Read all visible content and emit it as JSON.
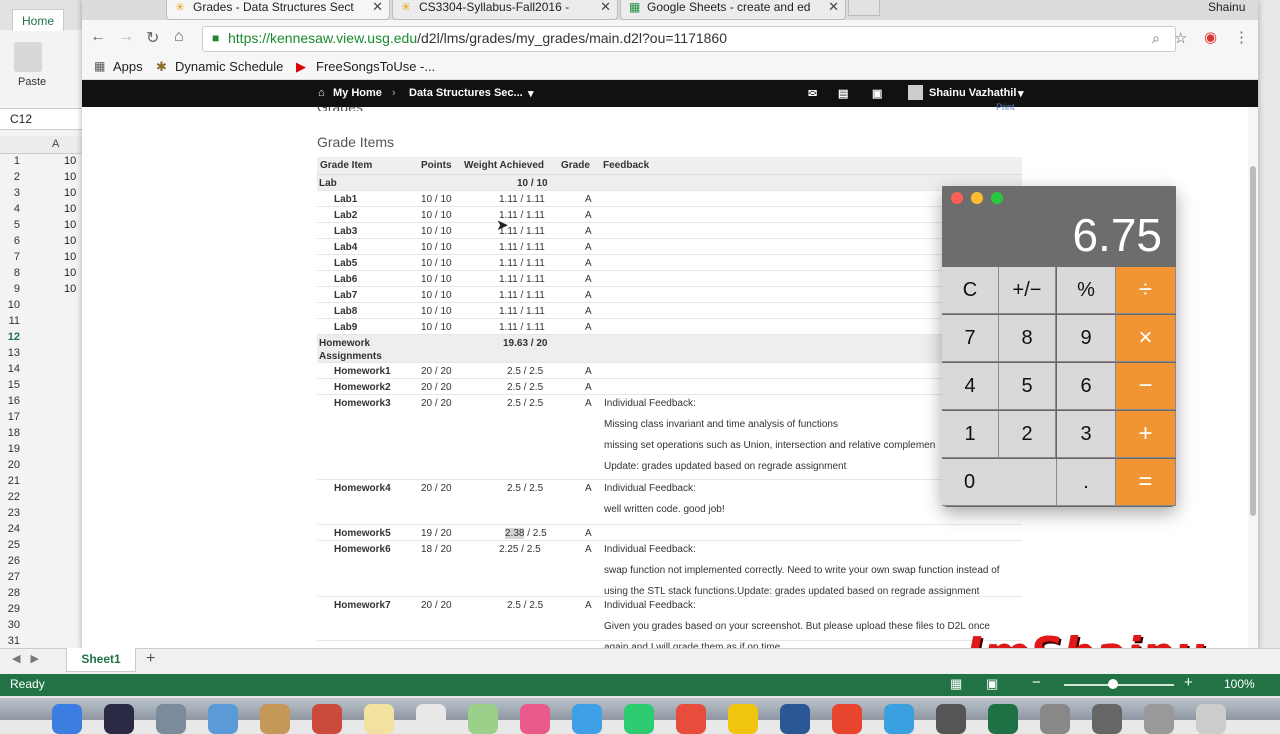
{
  "excel": {
    "home_tab": "Home",
    "paste_label": "Paste",
    "cell_ref": "C12",
    "col_header": "A",
    "rows": [
      {
        "n": "1",
        "v": "10"
      },
      {
        "n": "2",
        "v": "10"
      },
      {
        "n": "3",
        "v": "10"
      },
      {
        "n": "4",
        "v": "10"
      },
      {
        "n": "5",
        "v": "10"
      },
      {
        "n": "6",
        "v": "10"
      },
      {
        "n": "7",
        "v": "10"
      },
      {
        "n": "8",
        "v": "10"
      },
      {
        "n": "9",
        "v": "10"
      },
      {
        "n": "10",
        "v": ""
      },
      {
        "n": "11",
        "v": ""
      },
      {
        "n": "12",
        "v": ""
      },
      {
        "n": "13",
        "v": ""
      },
      {
        "n": "14",
        "v": ""
      },
      {
        "n": "15",
        "v": ""
      },
      {
        "n": "16",
        "v": ""
      },
      {
        "n": "17",
        "v": ""
      },
      {
        "n": "18",
        "v": ""
      },
      {
        "n": "19",
        "v": ""
      },
      {
        "n": "20",
        "v": ""
      },
      {
        "n": "21",
        "v": ""
      },
      {
        "n": "22",
        "v": ""
      },
      {
        "n": "23",
        "v": ""
      },
      {
        "n": "24",
        "v": ""
      },
      {
        "n": "25",
        "v": ""
      },
      {
        "n": "26",
        "v": ""
      },
      {
        "n": "27",
        "v": ""
      },
      {
        "n": "28",
        "v": ""
      },
      {
        "n": "29",
        "v": ""
      },
      {
        "n": "30",
        "v": ""
      },
      {
        "n": "31",
        "v": ""
      }
    ],
    "sheet_tab": "Sheet1",
    "add_sheet": "+",
    "status": "Ready",
    "zoom": "100%",
    "zoom_minus": "−",
    "zoom_plus": "+"
  },
  "browser": {
    "tabs": [
      {
        "title": "Grades - Data Structures Sect",
        "icon": "✳"
      },
      {
        "title": "CS3304-Syllabus-Fall2016 - ",
        "icon": "✳"
      },
      {
        "title": "Google Sheets - create and ed",
        "icon": "▦"
      }
    ],
    "profile": "Shainu",
    "url_host": "https://kennesaw.view.usg.edu",
    "url_path": "/d2l/lms/grades/my_grades/main.d2l?ou=1171860",
    "bookmarks": [
      "Apps",
      "Dynamic Schedule",
      "FreeSongsToUse -..."
    ]
  },
  "d2l": {
    "nav_home": "My Home",
    "nav_course": "Data Structures Sec...",
    "user": "Shainu Vazhathil",
    "page_title": "Grades",
    "print": "Print",
    "section_title": "Grade Items",
    "columns": [
      "Grade Item",
      "Points",
      "Weight Achieved",
      "Grade",
      "Feedback"
    ],
    "lab_category": {
      "name": "Lab",
      "weight": "10 / 10"
    },
    "labs": [
      {
        "name": "Lab1",
        "points": "10 / 10",
        "weight": "1.11 / 1.11",
        "grade": "A"
      },
      {
        "name": "Lab2",
        "points": "10 / 10",
        "weight": "1.11 / 1.11",
        "grade": "A"
      },
      {
        "name": "Lab3",
        "points": "10 / 10",
        "weight": "1.11 / 1.11",
        "grade": "A"
      },
      {
        "name": "Lab4",
        "points": "10 / 10",
        "weight": "1.11 / 1.11",
        "grade": "A"
      },
      {
        "name": "Lab5",
        "points": "10 / 10",
        "weight": "1.11 / 1.11",
        "grade": "A"
      },
      {
        "name": "Lab6",
        "points": "10 / 10",
        "weight": "1.11 / 1.11",
        "grade": "A"
      },
      {
        "name": "Lab7",
        "points": "10 / 10",
        "weight": "1.11 / 1.11",
        "grade": "A"
      },
      {
        "name": "Lab8",
        "points": "10 / 10",
        "weight": "1.11 / 1.11",
        "grade": "A"
      },
      {
        "name": "Lab9",
        "points": "10 / 10",
        "weight": "1.11 / 1.11",
        "grade": "A"
      }
    ],
    "hw_category": {
      "name_line1": "Homework",
      "name_line2": "Assignments",
      "weight": "19.63 / 20"
    },
    "homework": [
      {
        "name": "Homework1",
        "points": "20 / 20",
        "weight": "2.5 / 2.5",
        "grade": "A"
      },
      {
        "name": "Homework2",
        "points": "20 / 20",
        "weight": "2.5 / 2.5",
        "grade": "A"
      },
      {
        "name": "Homework3",
        "points": "20 / 20",
        "weight": "2.5 / 2.5",
        "grade": "A",
        "feedback": [
          "Individual Feedback:",
          "Missing class invariant and time analysis of functions",
          "missing set operations such as Union, intersection and relative complemen",
          "Update: grades updated based on regrade assignment"
        ]
      },
      {
        "name": "Homework4",
        "points": "20 / 20",
        "weight": "2.5 / 2.5",
        "grade": "A",
        "feedback": [
          "Individual Feedback:",
          "well written code. good job!"
        ]
      },
      {
        "name": "Homework5",
        "points": "19 / 20",
        "weight_hl": "2.38",
        "weight_rest": " / 2.5",
        "grade": "A"
      },
      {
        "name": "Homework6",
        "points": "18 / 20",
        "weight": "2.25 / 2.5",
        "grade": "A",
        "feedback": [
          "Individual Feedback:",
          "swap function not implemented correctly. Need to write your own swap function instead of",
          "using the STL stack functions.Update: grades updated based on regrade assignment"
        ]
      },
      {
        "name": "Homework7",
        "points": "20 / 20",
        "weight": "2.5 / 2.5",
        "grade": "A",
        "feedback": [
          "Individual Feedback:",
          "Given you grades based on your screenshot. But please upload these files to D2L once",
          "again and I will grade them as if on time."
        ]
      }
    ]
  },
  "calculator": {
    "display": "6.75",
    "keys": [
      [
        "C",
        "+/−",
        "%",
        "÷"
      ],
      [
        "7",
        "8",
        "9",
        "×"
      ],
      [
        "4",
        "5",
        "6",
        "−"
      ],
      [
        "1",
        "2",
        "3",
        "+"
      ],
      [
        "0",
        ".",
        "="
      ]
    ],
    "colors": {
      "operator": "#f09434",
      "digit": "#d9d9d9"
    }
  },
  "watermark": "ImShainu"
}
